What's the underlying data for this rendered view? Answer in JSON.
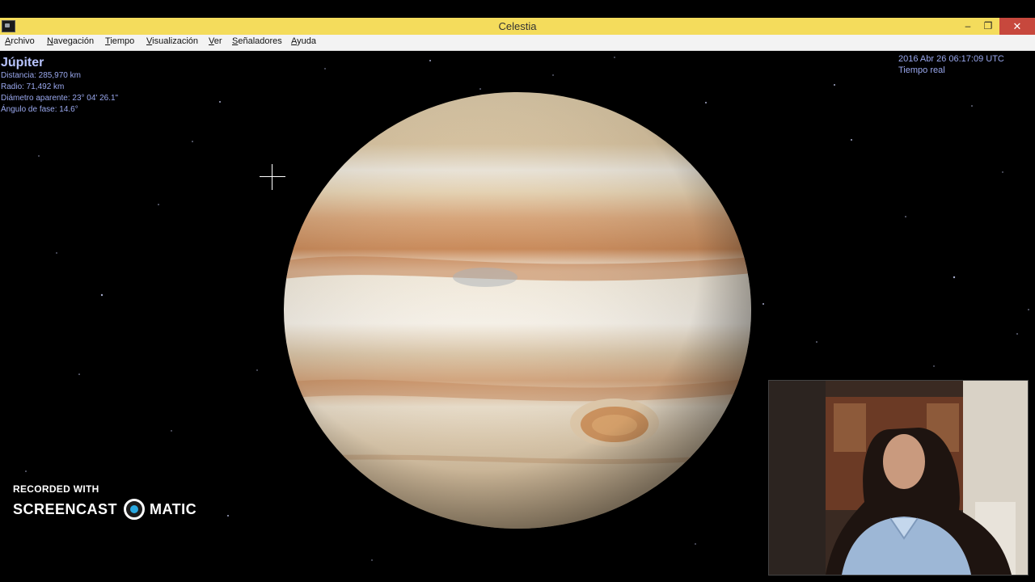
{
  "window": {
    "title": "Celestia",
    "minimize_label": "–",
    "maximize_label": "❐",
    "close_label": "✕"
  },
  "menu": {
    "items": [
      {
        "label": "Archivo"
      },
      {
        "label": "Navegación"
      },
      {
        "label": "Tiempo"
      },
      {
        "label": "Visualización"
      },
      {
        "label": "Ver"
      },
      {
        "label": "Señaladores"
      },
      {
        "label": "Ayuda"
      }
    ]
  },
  "object_info": {
    "name": "Júpiter",
    "distance": "Distancia: 285,970 km",
    "radius": "Radio: 71,492 km",
    "apparent_diameter": "Diámetro aparente: 23° 04' 26.1\"",
    "phase_angle": "Ángulo de fase: 14.6°"
  },
  "time_info": {
    "datetime": "2016 Abr 26 06:17:09 UTC",
    "mode": "Tiempo real"
  },
  "watermark": {
    "line1": "RECORDED WITH",
    "brand_left": "SCREENCAST",
    "brand_right": "MATIC"
  },
  "colors": {
    "titlebar": "#f4dc5c",
    "info_text": "#9aa8ee",
    "space": "#000000"
  }
}
